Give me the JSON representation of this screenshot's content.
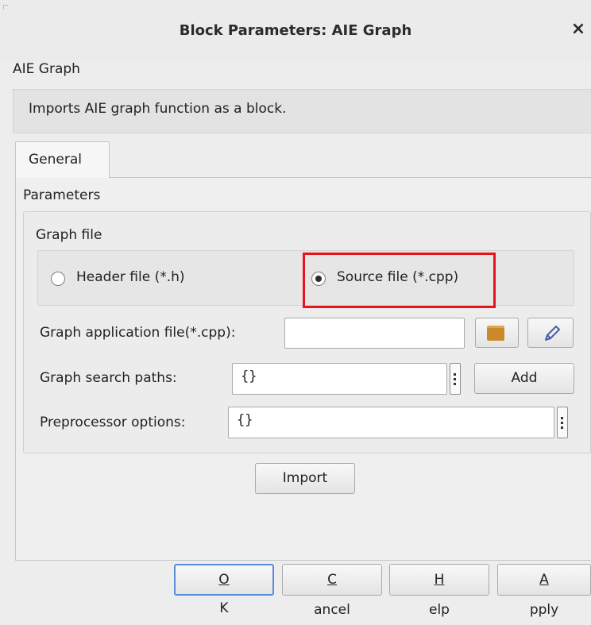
{
  "window": {
    "title": "Block Parameters: AIE Graph",
    "close_glyph": "×"
  },
  "block": {
    "name": "AIE Graph",
    "description": "Imports AIE graph function as a block."
  },
  "tabs": [
    {
      "label": "General",
      "selected": true
    }
  ],
  "parameters": {
    "label": "Parameters",
    "graph_file": {
      "label": "Graph file",
      "options": [
        {
          "label": "Header file (*.h)",
          "selected": false
        },
        {
          "label": "Source file (*.cpp)",
          "selected": true
        }
      ]
    },
    "app_file": {
      "label": "Graph application file(*.cpp):",
      "value": "",
      "browse_icon": "folder-icon",
      "edit_icon": "pencil-icon"
    },
    "search_paths": {
      "label": "Graph search paths:",
      "value": "{}",
      "add_label": "Add"
    },
    "preprocessor": {
      "label": "Preprocessor options:",
      "value": "{}"
    },
    "import_label": "Import"
  },
  "buttons": {
    "ok": {
      "mnemonic": "O",
      "rest": "K"
    },
    "cancel": {
      "mnemonic": "C",
      "rest": "ancel"
    },
    "help": {
      "mnemonic": "H",
      "rest": "elp"
    },
    "apply": {
      "mnemonic": "A",
      "rest": "pply"
    }
  },
  "colors": {
    "highlight": "#e8141c",
    "folder": "#c98a2b",
    "focus_border": "#5c8ed8"
  }
}
